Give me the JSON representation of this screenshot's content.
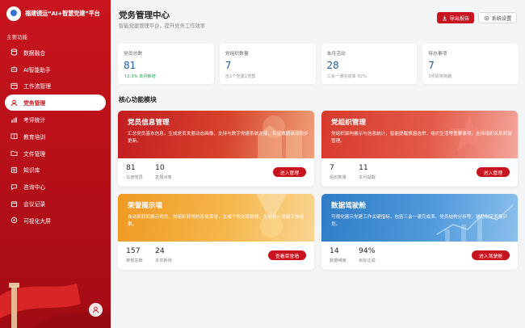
{
  "sidebar": {
    "brand_title": "福建镜运“AI+智慧党建”平台",
    "section_label": "主要功能",
    "items": [
      {
        "label": "数据融合",
        "icon": "database-icon"
      },
      {
        "label": "AI智能助手",
        "icon": "robot-icon"
      },
      {
        "label": "工作流管理",
        "icon": "workflow-icon"
      },
      {
        "label": "党务管理",
        "icon": "user-icon",
        "active": true
      },
      {
        "label": "考评统计",
        "icon": "chart-icon"
      },
      {
        "label": "教育培训",
        "icon": "book-icon"
      },
      {
        "label": "文件管理",
        "icon": "folder-icon"
      },
      {
        "label": "知识库",
        "icon": "library-icon"
      },
      {
        "label": "咨询中心",
        "icon": "chat-icon"
      },
      {
        "label": "会议记录",
        "icon": "calendar-icon"
      },
      {
        "label": "可视化大屏",
        "icon": "monitor-icon"
      }
    ]
  },
  "header": {
    "title": "党务管理中心",
    "subtitle": "智能党建管理平台，提升党务工作效率",
    "export_label": "导出报告",
    "settings_label": "系统设置"
  },
  "stats": [
    {
      "label": "党员总数",
      "value": "81",
      "note": "↑2.3% 本月新增",
      "note_color": "#1e9a4b"
    },
    {
      "label": "党组织数量",
      "value": "7",
      "note": "含1个党委1党群",
      "note_color": "#999999"
    },
    {
      "label": "本月活动",
      "value": "28",
      "note": "三会一课完成率 92%",
      "note_color": "#999999"
    },
    {
      "label": "待办事项",
      "value": "7",
      "note": "3项即将到期",
      "note_color": "#999999"
    }
  ],
  "section_title": "核心功能模块",
  "modules": [
    {
      "title": "党员信息管理",
      "desc": "汇总党员基本信息，生成党员发展动态画像，支持与数字党建系统对接，实现数据自动同步更新。",
      "metrics": [
        {
          "value": "81",
          "label": "在册党员"
        },
        {
          "value": "10",
          "label": "发展对象"
        }
      ],
      "button": "进入管理",
      "theme": "red"
    },
    {
      "title": "党组织管理",
      "desc": "党组织架构展示与信息统计，智能提醒换届选举、组织生活等重要事项，支持组织关系转接管理。",
      "metrics": [
        {
          "value": "7",
          "label": "组织数量"
        },
        {
          "value": "11",
          "label": "本月提醒"
        }
      ],
      "button": "进入管理",
      "theme": "red2"
    },
    {
      "title": "荣誉展示墙",
      "desc": "自动抓取和展示党员、党组织获得的各类荣誉，生成个性化荣誉榜，生动展示党建工作成果。",
      "metrics": [
        {
          "value": "157",
          "label": "荣誉总数"
        },
        {
          "value": "24",
          "label": "本年新增"
        }
      ],
      "button": "查看荣誉墙",
      "theme": "orange"
    },
    {
      "title": "数据驾驶舱",
      "desc": "可视化展示党建工作关键指标，包括三会一课完成率、党员结构分析等，辅助制定发展计划。",
      "metrics": [
        {
          "value": "14",
          "label": "数据维度"
        },
        {
          "value": "94%",
          "label": "目标达成"
        }
      ],
      "button": "进入驾驶舱",
      "theme": "blue"
    }
  ],
  "colors": {
    "accent": "#c8141e",
    "stat_value": "#1f5fa8"
  }
}
